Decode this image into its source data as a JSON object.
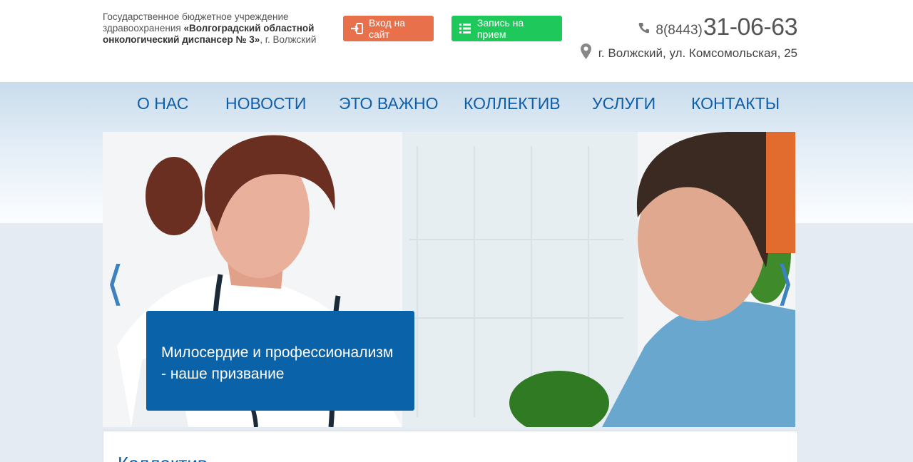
{
  "header": {
    "org_name_plain": "Государственное бюджетное учреждение здравоохранения ",
    "org_name_bold": "«Волгоградский областной онкологический диспансер № 3»",
    "org_city": ", г. Волжский",
    "login_button": "Вход на сайт",
    "appointment_button": "Запись на прием",
    "phone_code": "8(8443)",
    "phone_number": "31-06-63",
    "address": "г. Волжский, ул. Комсомольская, 25"
  },
  "nav": {
    "items": [
      {
        "label": "О НАС"
      },
      {
        "label": "НОВОСТИ"
      },
      {
        "label": "ЭТО ВАЖНО"
      },
      {
        "label": "КОЛЛЕКТИВ"
      },
      {
        "label": "УСЛУГИ"
      },
      {
        "label": "КОНТАКТЫ"
      }
    ]
  },
  "slider": {
    "caption": "Милосердие и профессионализм - наше призвание",
    "prev_icon": "chevron-left-icon",
    "next_icon": "chevron-right-icon"
  },
  "content": {
    "section_title": "Коллектив"
  },
  "colors": {
    "brand_blue": "#0e5ea8",
    "login_orange": "#e8704a",
    "appointment_green": "#1ec85a",
    "caption_bg": "#0a63a8"
  }
}
